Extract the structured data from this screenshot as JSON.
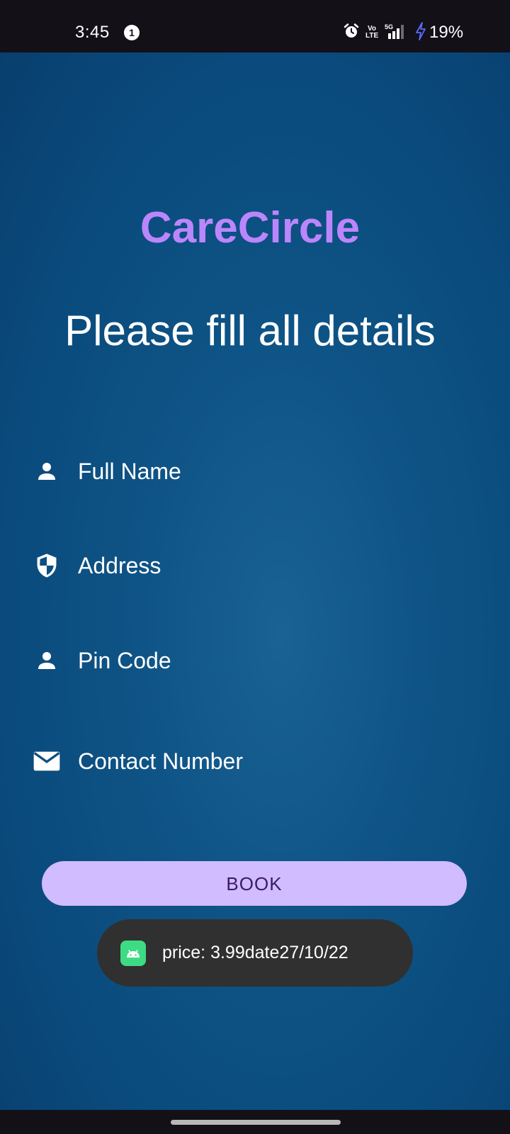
{
  "status_bar": {
    "time": "3:45",
    "notification_count": "1",
    "volte_top": "Vo",
    "volte_bottom": "LTE",
    "network": "5G",
    "battery": "19%"
  },
  "app": {
    "title": "CareCircle",
    "heading": "Please fill all details",
    "title_color": "#bb86fc"
  },
  "form": {
    "fields": [
      {
        "label": "Full Name",
        "icon": "person-icon"
      },
      {
        "label": "Address",
        "icon": "shield-icon"
      },
      {
        "label": "Pin Code",
        "icon": "person-icon"
      },
      {
        "label": "Contact Number",
        "icon": "email-icon"
      }
    ],
    "book_label": "BOOK",
    "button_color": "#d0bcff"
  },
  "toast": {
    "message": "price: 3.99date27/10/22",
    "icon": "android-icon"
  }
}
